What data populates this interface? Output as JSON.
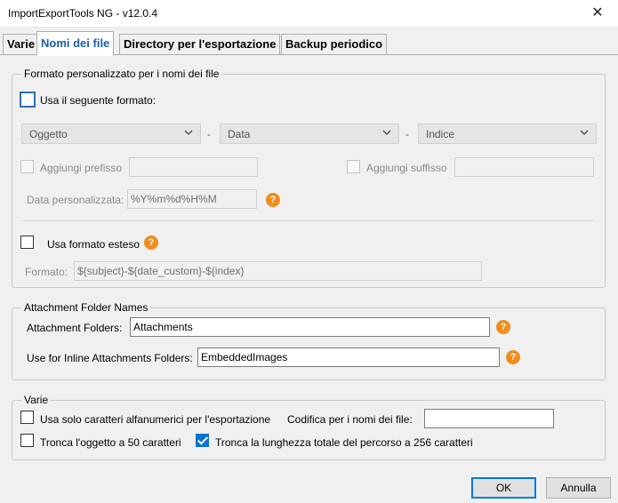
{
  "window": {
    "title": "ImportExportTools NG - v12.0.4",
    "close_glyph": "✕"
  },
  "tabs": [
    {
      "label": "Varie"
    },
    {
      "label": "Nomi dei file"
    },
    {
      "label": "Directory per l'esportazione"
    },
    {
      "label": "Backup periodico"
    }
  ],
  "format_group": {
    "legend": "Formato personalizzato per i nomi dei file",
    "use_format_label": "Usa il seguente formato:",
    "selects": [
      "Oggetto",
      "Data",
      "Indice"
    ],
    "separator": "-",
    "prefix_label": "Aggiungi prefisso",
    "suffix_label": "Aggiungi suffisso",
    "custom_date_label": "Data personalizzata:",
    "custom_date_value": "%Y%m%d%H%M",
    "extended_label": "Usa formato esteso",
    "format_label": "Formato:",
    "format_value": "${subject}-${date_custom}-${index}"
  },
  "attach_group": {
    "legend": "Attachment Folder Names",
    "folders_label": "Attachment Folders:",
    "folders_value": "Attachments",
    "inline_label": "Use for Inline Attachments Folders:",
    "inline_value": "EmbeddedImages"
  },
  "misc_group": {
    "legend": "Varie",
    "alnum_label": "Usa solo caratteri alfanumerici per l'esportazione",
    "encoding_label": "Codifica per i nomi dei file:",
    "encoding_value": "",
    "truncate_subject_label": "Tronca l'oggetto a 50 caratteri",
    "truncate_path_label": "Tronca la lunghezza totale del percorso a 256 caratteri",
    "truncate_path_checked": true
  },
  "help_glyph": "?",
  "buttons": {
    "ok": "OK",
    "cancel": "Annulla"
  },
  "colors": {
    "accent": "#0a72d4",
    "help": "#f28c1c",
    "active_tab_text": "#1a5fa8"
  }
}
